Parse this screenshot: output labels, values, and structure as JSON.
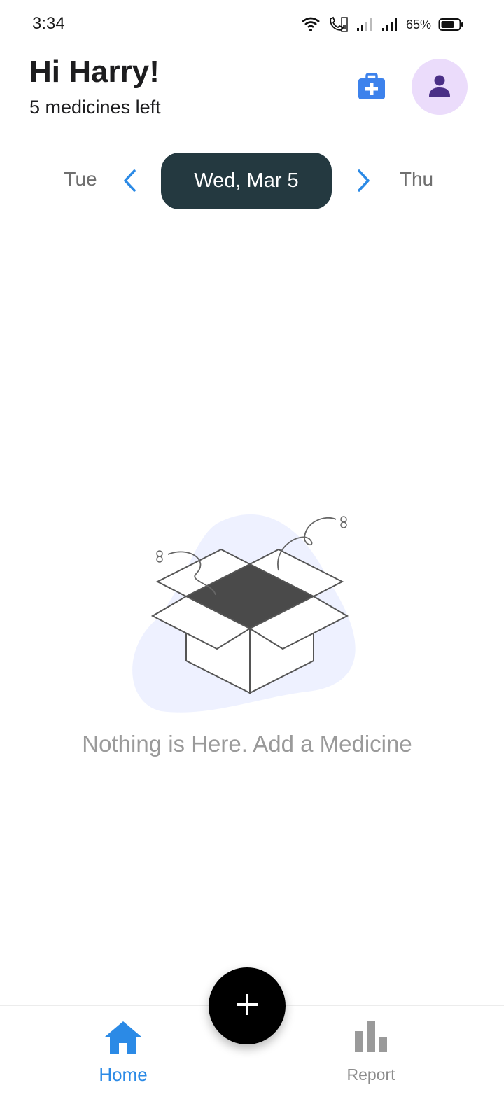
{
  "status_bar": {
    "time": "3:34",
    "battery": "65%",
    "icons": [
      "wifi-icon",
      "wifi-calling-icon",
      "signal-icon",
      "signal-icon",
      "battery-icon"
    ]
  },
  "header": {
    "greeting": "Hi Harry!",
    "subtitle": "5 medicines left",
    "kit_icon": "medical-kit-icon",
    "avatar_icon": "person-icon"
  },
  "date_nav": {
    "previous_day": "Tue",
    "current_date": "Wed, Mar 5",
    "next_day": "Thu"
  },
  "empty_state": {
    "message": "Nothing is Here. Add a Medicine",
    "illustration": "open-box-icon"
  },
  "bottom_nav": {
    "items": [
      {
        "label": "Home",
        "icon": "home-icon",
        "active": true
      },
      {
        "label": "Report",
        "icon": "bar-chart-icon",
        "active": false
      }
    ]
  },
  "fab": {
    "icon": "plus-icon"
  },
  "colors": {
    "accent": "#2b8ae6",
    "date_pill": "#243940",
    "avatar_bg": "#ebdcfb",
    "avatar_icon": "#4a2f86",
    "kit": "#3d82ec",
    "blob": "#eef1ff"
  }
}
